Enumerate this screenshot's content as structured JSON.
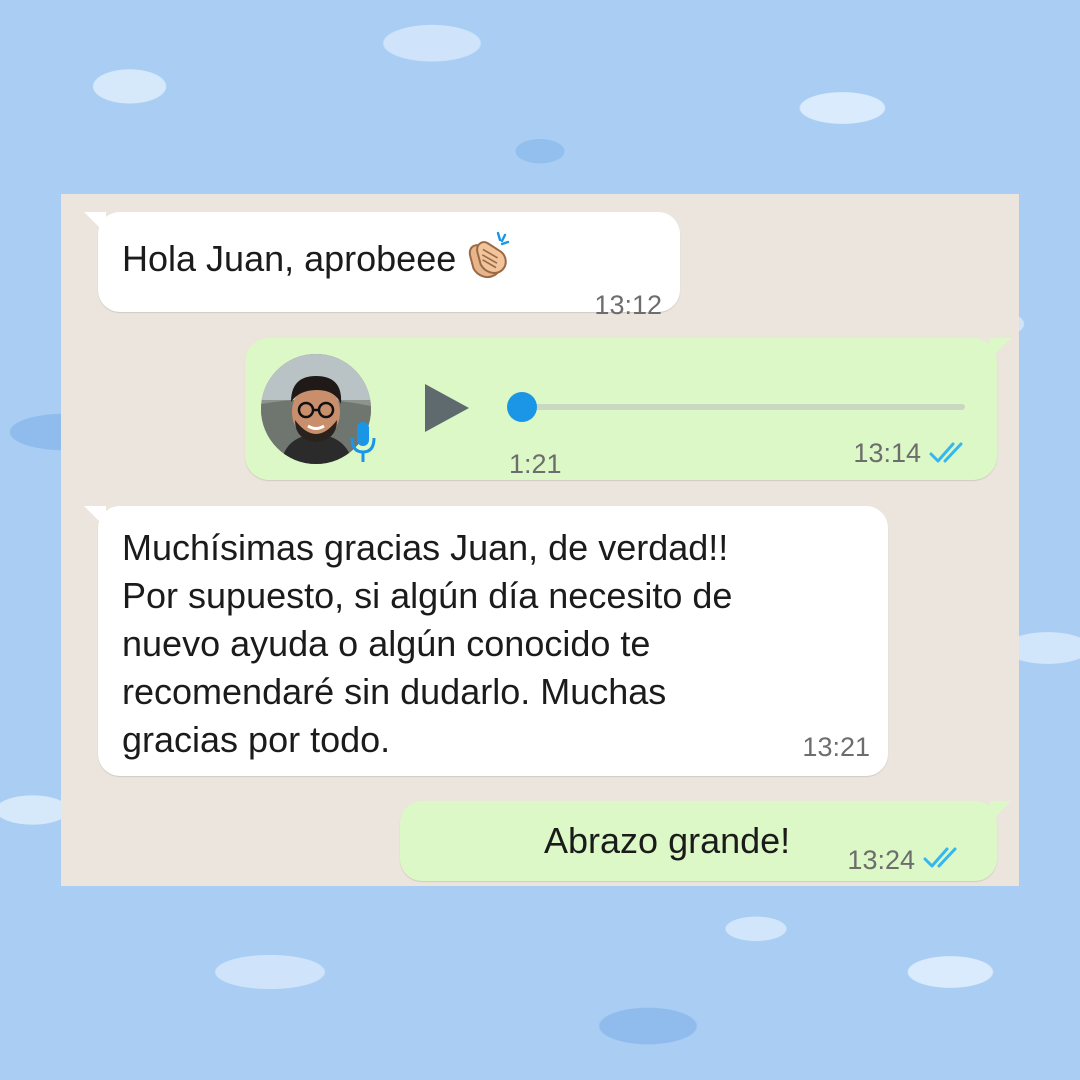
{
  "messages": [
    {
      "type": "text",
      "direction": "incoming",
      "text": "Hola Juan, aprobeee",
      "emoji": "clapping-hands",
      "time": "13:12"
    },
    {
      "type": "voice",
      "direction": "outgoing",
      "duration": "1:21",
      "progress": 0,
      "time": "13:14",
      "status": "read"
    },
    {
      "type": "text",
      "direction": "incoming",
      "lines": [
        "Muchísimas gracias Juan, de verdad!!",
        "Por supuesto, si algún día necesito de",
        "nuevo ayuda o algún conocido te",
        "recomendaré sin dudarlo. Muchas",
        "gracias por todo."
      ],
      "time": "13:21"
    },
    {
      "type": "text",
      "direction": "outgoing",
      "text": "Abrazo grande!",
      "time": "13:24",
      "status": "read"
    }
  ],
  "colors": {
    "incoming_bubble": "#ffffff",
    "outgoing_bubble": "#dcf8c6",
    "chat_background": "#ece5dd",
    "read_ticks": "#34b7f1",
    "voice_accent": "#1b96e6",
    "page_background": "#a9cdf3"
  }
}
